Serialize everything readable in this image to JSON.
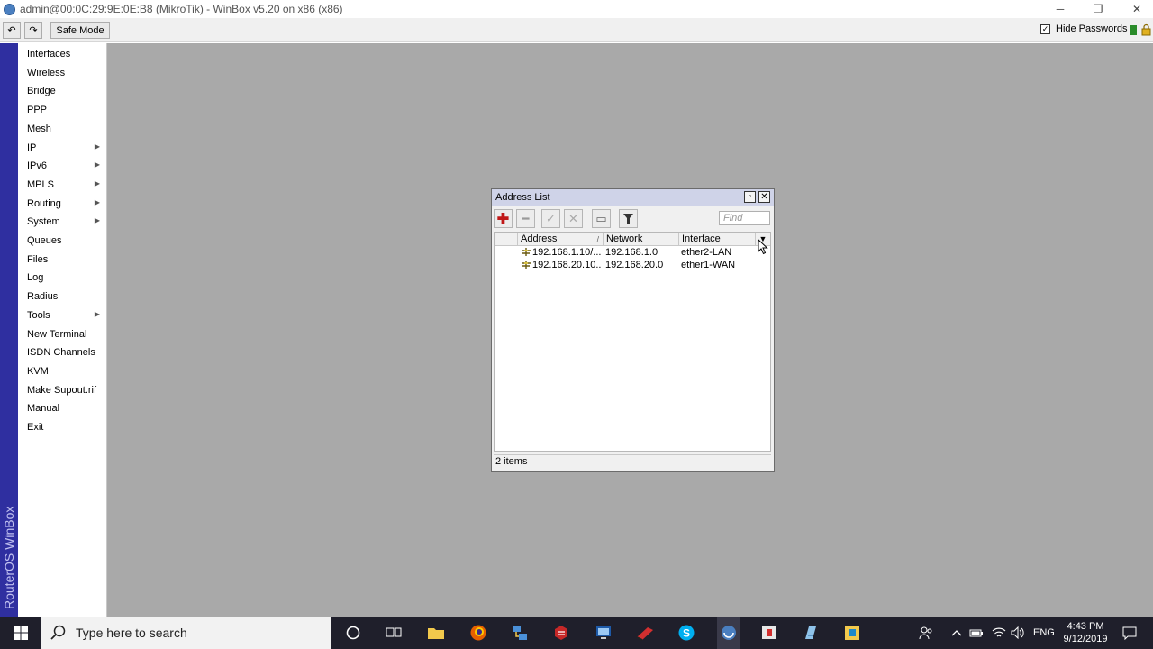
{
  "window": {
    "title": "admin@00:0C:29:9E:0E:B8 (MikroTik) - WinBox v5.20 on x86 (x86)",
    "controls": {
      "minimize": "─",
      "maximize": "❐",
      "close": "✕"
    }
  },
  "toolbar": {
    "undo_label": "↶",
    "redo_label": "↷",
    "safe_mode_label": "Safe Mode",
    "hide_passwords_label": "Hide Passwords",
    "hide_passwords_checked": true
  },
  "side_strip": {
    "text": "RouterOS WinBox"
  },
  "menu": {
    "items": [
      {
        "label": "Interfaces",
        "submenu": false
      },
      {
        "label": "Wireless",
        "submenu": false
      },
      {
        "label": "Bridge",
        "submenu": false
      },
      {
        "label": "PPP",
        "submenu": false
      },
      {
        "label": "Mesh",
        "submenu": false
      },
      {
        "label": "IP",
        "submenu": true
      },
      {
        "label": "IPv6",
        "submenu": true
      },
      {
        "label": "MPLS",
        "submenu": true
      },
      {
        "label": "Routing",
        "submenu": true
      },
      {
        "label": "System",
        "submenu": true
      },
      {
        "label": "Queues",
        "submenu": false
      },
      {
        "label": "Files",
        "submenu": false
      },
      {
        "label": "Log",
        "submenu": false
      },
      {
        "label": "Radius",
        "submenu": false
      },
      {
        "label": "Tools",
        "submenu": true
      },
      {
        "label": "New Terminal",
        "submenu": false
      },
      {
        "label": "ISDN Channels",
        "submenu": false
      },
      {
        "label": "KVM",
        "submenu": false
      },
      {
        "label": "Make Supout.rif",
        "submenu": false
      },
      {
        "label": "Manual",
        "submenu": false
      },
      {
        "label": "Exit",
        "submenu": false
      }
    ]
  },
  "address_list": {
    "title": "Address List",
    "find_placeholder": "Find",
    "columns": {
      "address": "Address",
      "network": "Network",
      "interface": "Interface"
    },
    "rows": [
      {
        "address": "192.168.1.10/...",
        "network": "192.168.1.0",
        "interface": "ether2-LAN"
      },
      {
        "address": "192.168.20.10...",
        "network": "192.168.20.0",
        "interface": "ether1-WAN"
      }
    ],
    "status": "2 items"
  },
  "taskbar": {
    "search_placeholder": "Type here to search",
    "language": "ENG",
    "time": "4:43 PM",
    "date": "9/12/2019"
  }
}
